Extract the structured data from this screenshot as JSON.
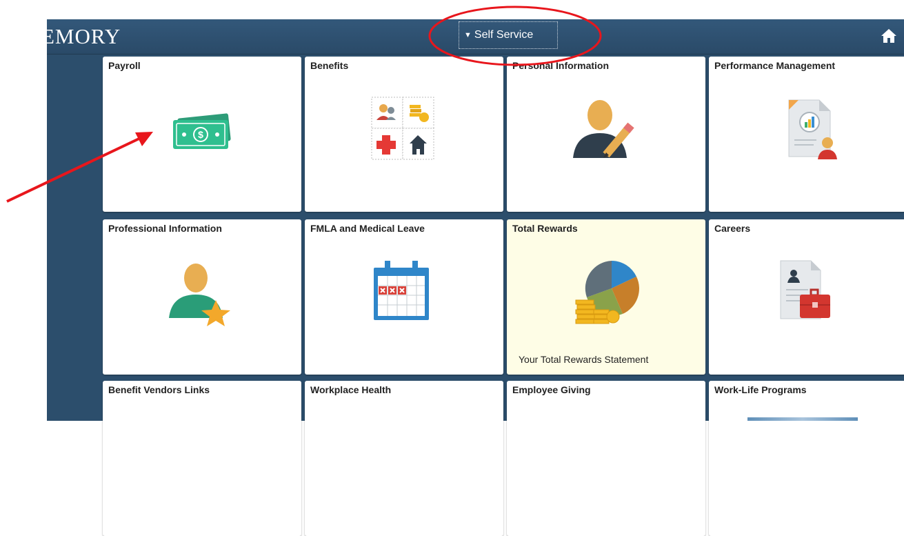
{
  "header": {
    "logo": "EMORY",
    "menu_label": "Self Service"
  },
  "tiles": [
    {
      "title": "Payroll",
      "icon": "money-icon"
    },
    {
      "title": "Benefits",
      "icon": "benefits-grid-icon"
    },
    {
      "title": "Personal Information",
      "icon": "person-pencil-icon"
    },
    {
      "title": "Performance Management",
      "icon": "report-chart-icon"
    },
    {
      "title": "Professional Information",
      "icon": "person-star-icon"
    },
    {
      "title": "FMLA and Medical Leave",
      "icon": "calendar-icon"
    },
    {
      "title": "Total Rewards",
      "subtitle": "Your Total Rewards Statement",
      "icon": "pie-chart-coins-icon"
    },
    {
      "title": "Careers",
      "icon": "resume-briefcase-icon"
    },
    {
      "title": "Benefit Vendors Links"
    },
    {
      "title": "Workplace Health"
    },
    {
      "title": "Employee Giving"
    },
    {
      "title": "Work-Life Programs"
    }
  ],
  "colors": {
    "frame": "#2c4e6c",
    "tile_highlight": "#fefde6",
    "annotation": "#e8161c"
  }
}
